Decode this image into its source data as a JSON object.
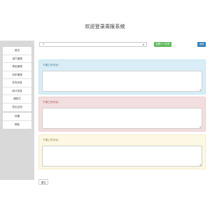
{
  "header": {
    "title": "欢迎登录周报系统"
  },
  "sidebar": {
    "main_items": [
      {
        "label": "首页"
      },
      {
        "label": "用户管理"
      },
      {
        "label": "角色管理"
      },
      {
        "label": "历史管理"
      },
      {
        "label": "任务信息"
      },
      {
        "label": "统计信息"
      },
      {
        "label": "通知栏"
      },
      {
        "label": "意见反馈"
      }
    ],
    "sub_items": [
      {
        "label": "设置"
      },
      {
        "label": "帮助"
      }
    ]
  },
  "toolbar": {
    "select_value": "1",
    "green_button_label": "查看个人任务",
    "blue_button_label": "返回"
  },
  "panels": [
    {
      "label": "下周工作计划：",
      "color": "#d9edf7"
    },
    {
      "label": "下周工作计划：",
      "color": "#f2dede"
    },
    {
      "label": "下周工作计划：",
      "color": "#fcf8e3"
    }
  ],
  "submit_label": "提交"
}
